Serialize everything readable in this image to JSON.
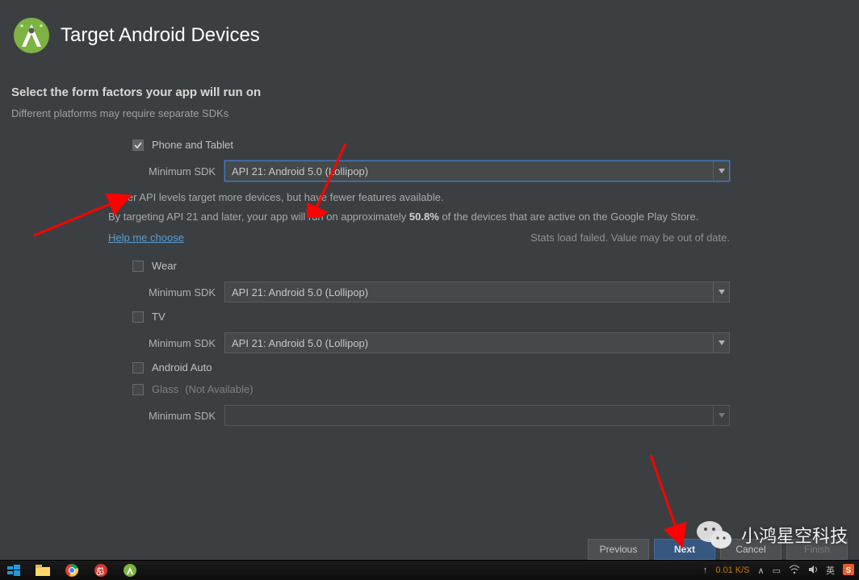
{
  "header": {
    "title": "Target Android Devices"
  },
  "section": {
    "heading": "Select the form factors your app will run on",
    "sub": "Different platforms may require separate SDKs"
  },
  "labels": {
    "min_sdk": "Minimum SDK",
    "not_available": "(Not Available)"
  },
  "form_factors": {
    "phone_tablet": {
      "label": "Phone and Tablet",
      "checked": true,
      "sdk": "API 21: Android 5.0 (Lollipop)"
    },
    "wear": {
      "label": "Wear",
      "checked": false,
      "sdk": "API 21: Android 5.0 (Lollipop)"
    },
    "tv": {
      "label": "TV",
      "checked": false,
      "sdk": "API 21: Android 5.0 (Lollipop)"
    },
    "auto": {
      "label": "Android Auto",
      "checked": false
    },
    "glass": {
      "label": "Glass",
      "checked": false,
      "sdk": ""
    }
  },
  "info": {
    "line1": "Lower API levels target more devices, but have fewer features available.",
    "line2_pre": "By targeting API 21 and later, your app will run on approximately ",
    "pct": "50.8%",
    "line2_post": " of the devices that are active on the Google Play Store.",
    "help": "Help me choose",
    "stats_fail": "Stats load failed. Value may be out of date."
  },
  "buttons": {
    "previous": "Previous",
    "next": "Next",
    "cancel": "Cancel",
    "finish": "Finish"
  },
  "taskbar": {
    "net_speed": "0.01 K/S",
    "ime": "英"
  },
  "watermark": {
    "text": "小鸿星空科技"
  }
}
